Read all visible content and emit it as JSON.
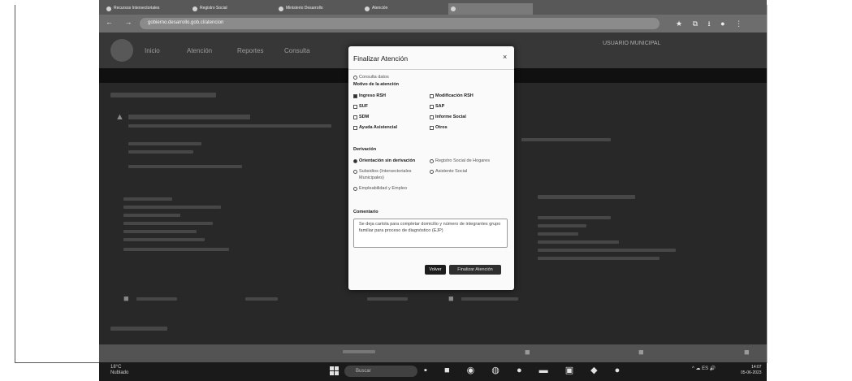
{
  "browser": {
    "tabs": [
      "Recursos Intersectoriales",
      "Registro Social",
      "Ministerio Desarrollo",
      "Atención",
      ""
    ],
    "url": "gobierno.desarrollo.gob.cl/atencion"
  },
  "site": {
    "nav": [
      "Inicio",
      "Atención",
      "Reportes",
      "Consulta"
    ],
    "user_name": "USUARIO MUNICIPAL"
  },
  "taskbar": {
    "weather_temp": "18°C",
    "weather_desc": "Nublado",
    "search_placeholder": "Buscar",
    "lang": "ES",
    "time": "14:07",
    "date": "05-06-2023"
  },
  "modal": {
    "title": "Finalizar Atención",
    "close": "×",
    "consulta_label": "Consulta datos",
    "motivo_label": "Motivo de la atención",
    "motivos": [
      {
        "label": "Ingreso RSH",
        "checked": true
      },
      {
        "label": "Modificación RSH",
        "checked": false
      },
      {
        "label": "SUF",
        "checked": false
      },
      {
        "label": "SAP",
        "checked": false
      },
      {
        "label": "SDM",
        "checked": false
      },
      {
        "label": "Informe Social",
        "checked": false
      },
      {
        "label": "Ayuda Asistencial",
        "checked": false
      },
      {
        "label": "Otros",
        "checked": false
      }
    ],
    "derivacion_label": "Derivación",
    "derivaciones": [
      {
        "label": "Orientación sin derivación",
        "checked": true
      },
      {
        "label": "Registro Social de Hogares",
        "checked": false
      },
      {
        "label": "Subsidios (Intersectoriales",
        "checked": false
      },
      {
        "label": "Municipales)",
        "checked": false
      },
      {
        "label": "Asistente Social",
        "checked": false
      },
      {
        "label": "Empleabilidad y Empleo",
        "checked": false
      }
    ],
    "comentario_label": "Comentario",
    "comentario_text": "Se deja cartola para completar domicilio y número de integrantes grupo familiar para proceso de diagnóstico (EJP)",
    "volver": "Volver",
    "finalizar": "Finalizar Atención"
  }
}
